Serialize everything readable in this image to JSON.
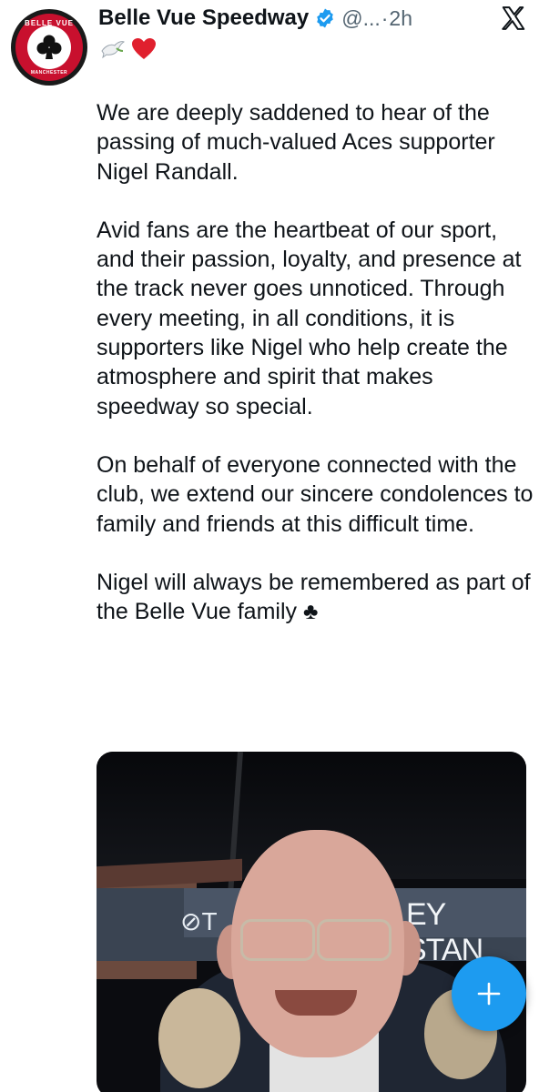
{
  "colors": {
    "accent": "#1d9bf0",
    "text": "#0f1419",
    "muted": "#536471"
  },
  "author": {
    "display_name": "Belle Vue Speedway",
    "handle": "@...",
    "separator": "·",
    "time": "2h",
    "verified": true,
    "avatar": {
      "top_text": "BELLE VUE ACES",
      "bottom_text": "MANCHESTER",
      "icon": "club-suit-icon"
    },
    "bio_emojis": [
      "dove-icon",
      "red-heart-icon"
    ]
  },
  "tweet": {
    "paragraphs": [
      "We are deeply saddened to hear of the passing of much-valued Aces supporter Nigel Randall.",
      "Avid fans are the heartbeat of our sport, and their passion, loyalty, and presence at the track never goes unnoticed. Through every meeting, in all conditions, it is supporters like Nigel who help create the atmosphere and spirit that makes speedway so special.",
      "On behalf of everyone connected with the club, we extend our sincere condolences to family and friends at this difficult time.",
      "Nigel will always be remembered as part of the Belle Vue family"
    ],
    "closing_emoji": "♣",
    "media": {
      "sign_left": "⊘T",
      "sign_right": "EY STAN"
    }
  },
  "compose_button": {
    "label": "+"
  }
}
